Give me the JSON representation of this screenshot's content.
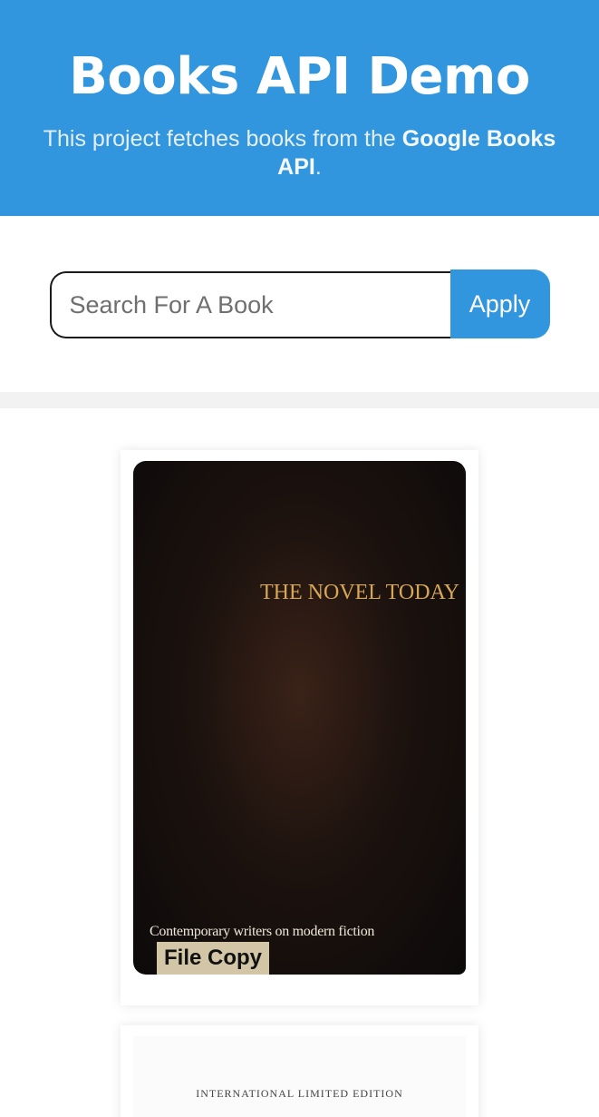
{
  "header": {
    "title": "Books API Demo",
    "description_prefix": "This project fetches books from the ",
    "description_bold": "Google Books API",
    "description_suffix": "."
  },
  "search": {
    "placeholder": "Search For A Book",
    "value": "",
    "apply_label": "Apply"
  },
  "books": [
    {
      "cover_title": "THE NOVEL TODAY",
      "cover_subtitle": "Contemporary writers on modern fiction",
      "cover_sticker": "File Copy"
    },
    {
      "cover_edition": "INTERNATIONAL LIMITED EDITION"
    }
  ],
  "colors": {
    "brand": "#3196dd",
    "header_text": "#ffffff",
    "input_border": "#1a1a1a"
  }
}
